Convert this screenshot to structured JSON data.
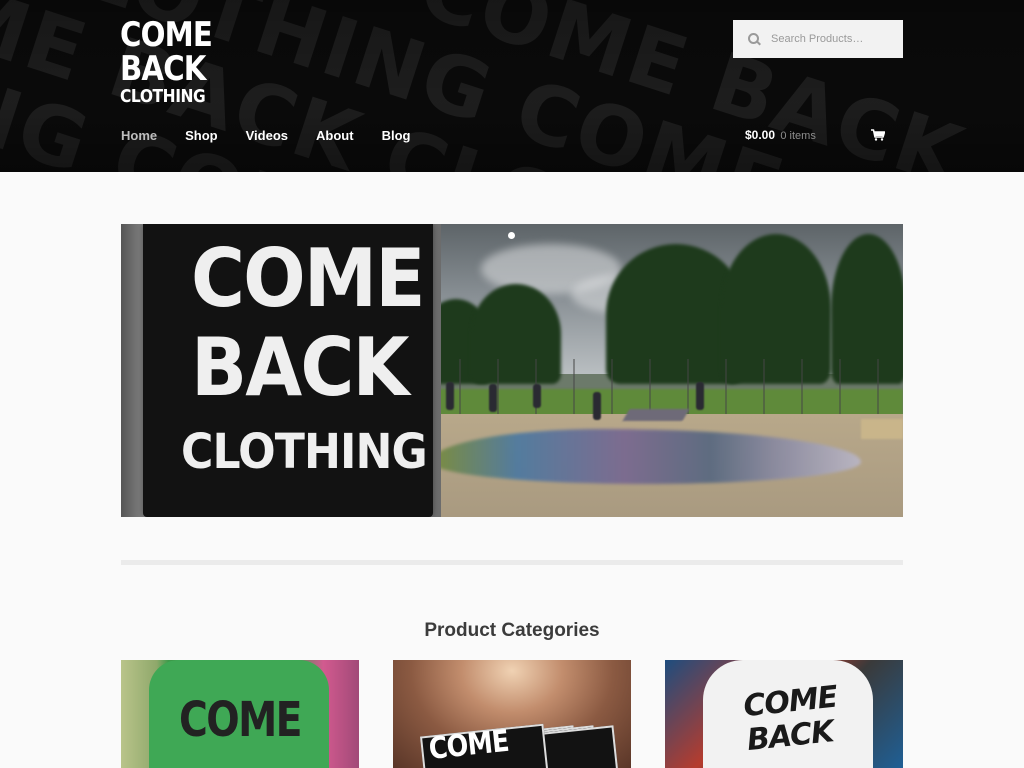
{
  "brand": {
    "logo_line1": "COME",
    "logo_line2": "BACK",
    "logo_line3": "CLOTHING",
    "header_bg_text": [
      "CLOTHING COME BACK",
      "BACK CLOTHING COME",
      "COME BACK CLOTHING",
      "CLOTHING COME BACK"
    ]
  },
  "search": {
    "placeholder": "Search Products…",
    "icon": "search-icon"
  },
  "nav": {
    "items": [
      {
        "label": "Home",
        "active": true
      },
      {
        "label": "Shop",
        "active": false
      },
      {
        "label": "Videos",
        "active": false
      },
      {
        "label": "About",
        "active": false
      },
      {
        "label": "Blog",
        "active": false
      }
    ]
  },
  "cart": {
    "amount": "$0.00",
    "items": "0 items",
    "icon": "cart-icon"
  },
  "hero": {
    "sticker_line1": "COME",
    "sticker_line2": "BACK",
    "sticker_line3": "CLOTHING"
  },
  "sections": {
    "categories_title": "Product Categories"
  },
  "categories": [
    {
      "image_text": "COME"
    },
    {
      "image_text": "COME"
    },
    {
      "image_text": "COME BACK"
    }
  ],
  "colors": {
    "header_bg": "#0b0b0b",
    "page_bg": "#fafafa",
    "nav_active": "#bdbdbd"
  }
}
